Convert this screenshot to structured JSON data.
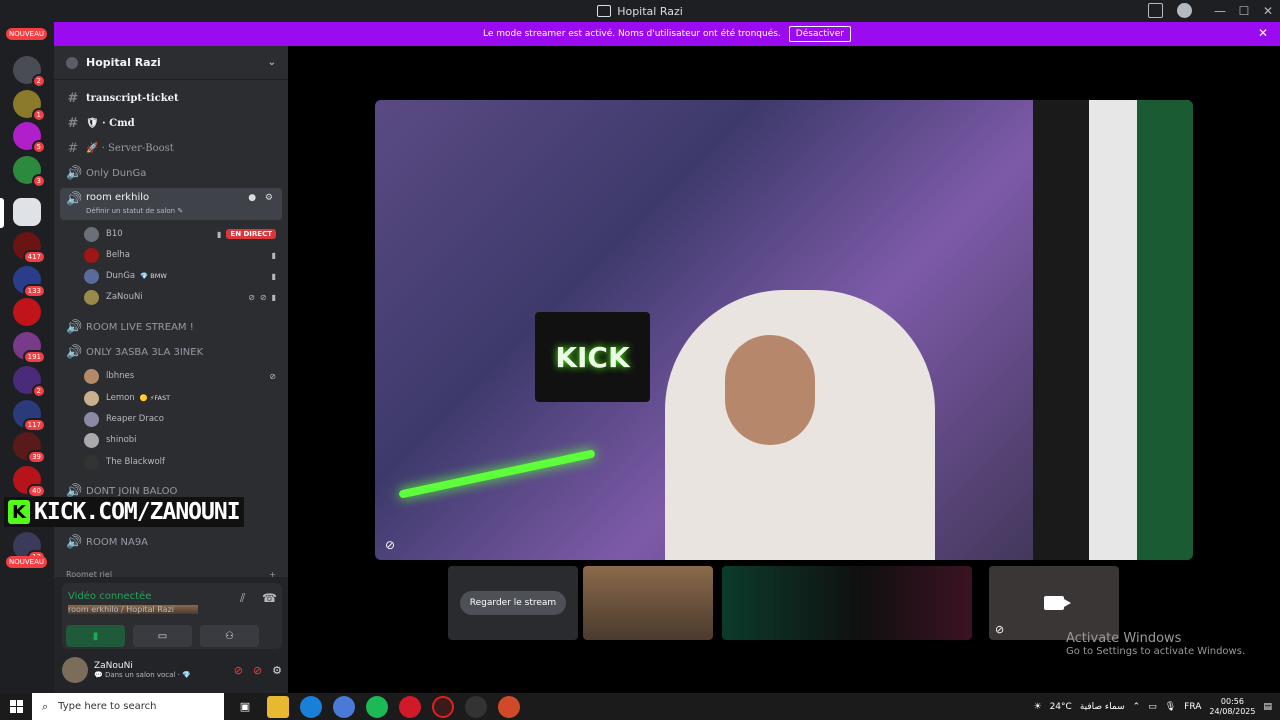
{
  "window": {
    "title": "Hopital Razi"
  },
  "banner": {
    "text": "Le mode streamer est activé. Noms d'utilisateur ont été tronqués.",
    "button": "Désactiver"
  },
  "servers": {
    "new_badge": "NOUVEAU",
    "badges": [
      "2",
      "2",
      "1",
      "5",
      "3",
      "",
      "417",
      "133",
      "",
      "191",
      "2",
      "117",
      "39",
      "40",
      "13"
    ]
  },
  "guild": {
    "name": "Hopital Razi"
  },
  "channels": [
    {
      "icon": "#",
      "name": "transcript-ticket"
    },
    {
      "icon": "#",
      "name": "🛡 · Cmd"
    },
    {
      "icon": "#",
      "name": "🚀 · Server-Boost"
    },
    {
      "icon": "🔊",
      "name": "Only DunGa"
    },
    {
      "icon": "🔊",
      "name": "room erkhilo",
      "status": "Définir un statut de salon ✎"
    },
    {
      "icon": "🔊",
      "name": "ROOM LIVE STREAM !"
    },
    {
      "icon": "🔊",
      "name": "ONLY 3ASBA 3LA 3INEK"
    },
    {
      "icon": "🔊",
      "name": "DONT JOIN BALOO"
    },
    {
      "icon": "🔊",
      "name": "ROOM NA9A"
    },
    {
      "icon": "",
      "name": "Roomet riel"
    }
  ],
  "room_users": [
    {
      "name": "B10",
      "live": "EN DIRECT"
    },
    {
      "name": "Belha",
      "tag": ""
    },
    {
      "name": "DunGa",
      "tag": "💎 BMW"
    },
    {
      "name": "ZaNouNi",
      "tag": ""
    }
  ],
  "only_users": [
    {
      "name": "lbhnes",
      "tag": ""
    },
    {
      "name": "Lemon",
      "tag": "🟡 ⚡FAST"
    },
    {
      "name": "Reaper Draco",
      "tag": ""
    },
    {
      "name": "shinobi",
      "tag": ""
    },
    {
      "name": "The Blackwolf",
      "tag": ""
    }
  ],
  "overlay": {
    "kick_text": "KICK.COM/ZANOUNI",
    "sign": "KICK"
  },
  "voice": {
    "status": "Vidéo connectée",
    "location": "room erkhilo / Hopital Razi"
  },
  "user": {
    "name": "ZaNouNi",
    "sub": "💬 Dans un salon vocal · 💎"
  },
  "stage": {
    "watch_button": "Regarder le stream"
  },
  "activate": {
    "line1": "Activate Windows",
    "line2": "Go to Settings to activate Windows."
  },
  "taskbar": {
    "search": "Type here to search",
    "temp": "24°C",
    "weather": "سماء صافية",
    "lang": "FRA",
    "time": "00:56",
    "date": "24/08/2025"
  },
  "colors": {
    "banner": "#9b0bf0",
    "live": "#da373c",
    "connected": "#23a55a",
    "kick": "#53fc18"
  }
}
